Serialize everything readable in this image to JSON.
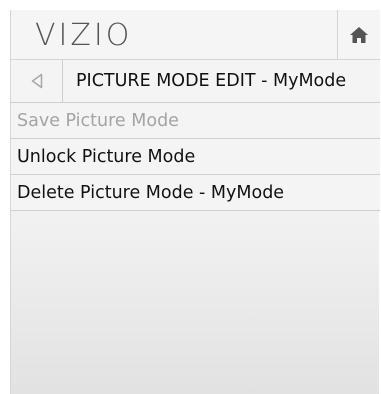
{
  "header": {
    "logo_text": "VIZIO",
    "home_icon": "home-icon"
  },
  "titlebar": {
    "back_icon": "back-triangle-icon",
    "title": "PICTURE MODE EDIT - MyMode"
  },
  "menu": {
    "items": [
      {
        "label": "Save Picture Mode",
        "enabled": false
      },
      {
        "label": "Unlock Picture Mode",
        "enabled": true
      },
      {
        "label": "Delete Picture Mode - MyMode",
        "enabled": true
      }
    ]
  },
  "colors": {
    "disabled_text": "#a4a4a4",
    "text": "#111111",
    "logo": "#555555"
  }
}
